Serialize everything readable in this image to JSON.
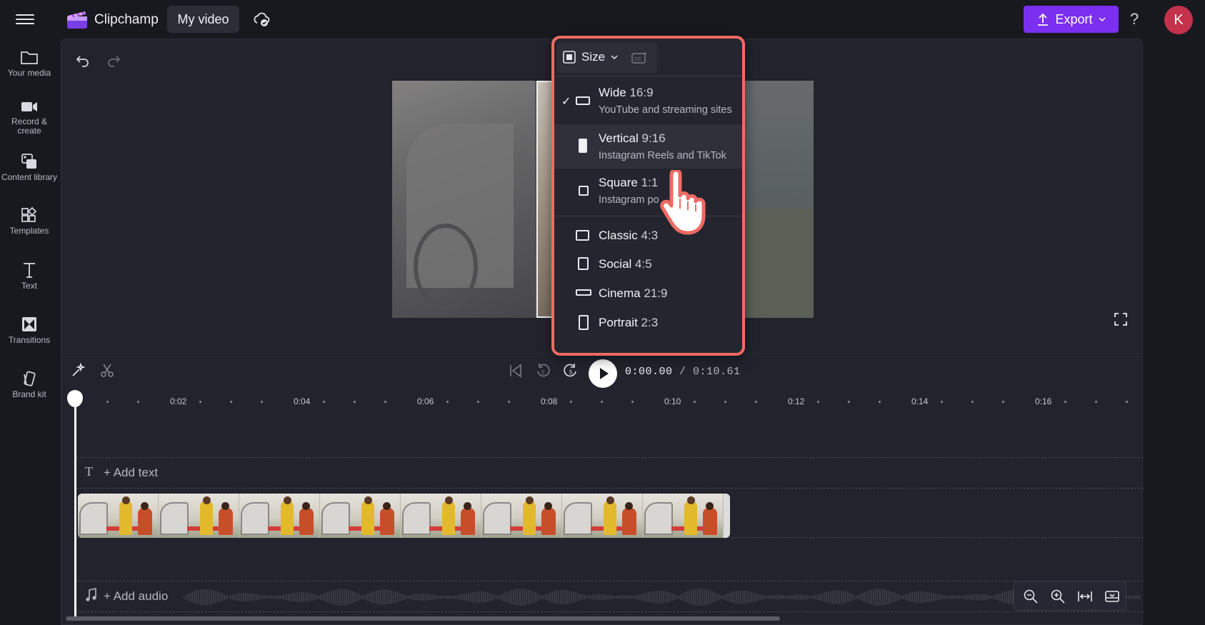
{
  "header": {
    "app_name": "Clipchamp",
    "project_title": "My video",
    "export_label": "Export",
    "help_glyph": "?",
    "avatar_initial": "K"
  },
  "sidebar": {
    "items": [
      {
        "label": "Your media",
        "icon": "folder-icon"
      },
      {
        "label": "Record & create",
        "icon": "camera-icon"
      },
      {
        "label": "Content library",
        "icon": "content-library-icon"
      },
      {
        "label": "Templates",
        "icon": "templates-icon"
      },
      {
        "label": "Text",
        "icon": "text-icon"
      },
      {
        "label": "Transitions",
        "icon": "transitions-icon"
      },
      {
        "label": "Brand kit",
        "icon": "brand-kit-icon"
      }
    ]
  },
  "size_menu": {
    "button_label": "Size",
    "options": [
      {
        "name": "Wide",
        "ratio": "16:9",
        "desc": "YouTube and streaming sites",
        "selected": true
      },
      {
        "name": "Vertical",
        "ratio": "9:16",
        "desc": "Instagram Reels and TikTok",
        "selected": false
      },
      {
        "name": "Square",
        "ratio": "1:1",
        "desc": "Instagram po",
        "selected": false
      },
      {
        "name": "Classic",
        "ratio": "4:3",
        "desc": "",
        "selected": false
      },
      {
        "name": "Social",
        "ratio": "4:5",
        "desc": "",
        "selected": false
      },
      {
        "name": "Cinema",
        "ratio": "21:9",
        "desc": "",
        "selected": false
      },
      {
        "name": "Portrait",
        "ratio": "2:3",
        "desc": "",
        "selected": false
      }
    ]
  },
  "playback": {
    "current_time": "0:00.00",
    "total_time": "/ 0:10.61"
  },
  "ruler": {
    "labels": [
      "0:02",
      "0:04",
      "0:06",
      "0:08",
      "0:10",
      "0:12",
      "0:14",
      "0:16"
    ]
  },
  "timeline": {
    "add_text_label": "+ Add text",
    "add_audio_label": "+ Add audio",
    "text_track_glyph": "T"
  },
  "colors": {
    "accent": "#7b2ff0",
    "highlight_border": "#ef6b63",
    "avatar": "#c4314b"
  }
}
